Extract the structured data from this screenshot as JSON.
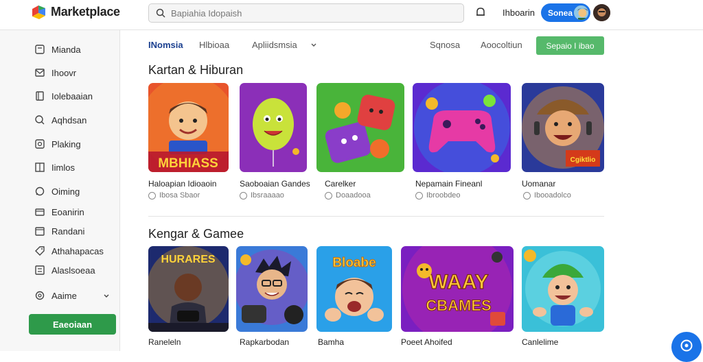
{
  "header": {
    "app_name": "Marketplace",
    "search_placeholder": "Bapiahia Idopaish",
    "signin_link": "Ihboarin",
    "signin_button": "Sonea",
    "bell_icon": "bell-icon",
    "search_icon": "search-icon"
  },
  "sidebar": {
    "items": [
      {
        "label": "Mianda",
        "icon": "card-icon"
      },
      {
        "label": "Ihoovr",
        "icon": "mail-icon"
      },
      {
        "label": "Iolebaaian",
        "icon": "doc-icon"
      },
      {
        "label": "Aqhdsan",
        "icon": "search-icon"
      },
      {
        "label": "Plaking",
        "icon": "image-icon"
      },
      {
        "label": "Iimlos",
        "icon": "grid-icon"
      },
      {
        "label": "Oiming",
        "icon": "chat-icon"
      },
      {
        "label": "Eoanirin",
        "icon": "box-icon"
      },
      {
        "label": "Randani",
        "icon": "calendar-icon"
      },
      {
        "label": "Athahapacas",
        "icon": "tag-icon"
      },
      {
        "label": "Alaslsoeaa",
        "icon": "list-icon"
      },
      {
        "label": "Aaime",
        "icon": "settings-icon"
      }
    ],
    "cta": "Eaeoiaan"
  },
  "subnav": {
    "tabs": [
      "INomsia",
      "Hlbioaa",
      "Apliidsmsia"
    ],
    "right_links": [
      "Sqnosa",
      "Aoocoltiun"
    ],
    "button": "Sepaio I ibao"
  },
  "sections": [
    {
      "title": "Kartan & Hiburan",
      "cards": [
        {
          "title": "Haloapian Idioaoin",
          "meta": "Ibosa Sbaor"
        },
        {
          "title": "Saoboaian Gandes",
          "meta": "Ibsraaaao"
        },
        {
          "title": "Carelker",
          "meta": "Doaadooa"
        },
        {
          "title": "Nepamain Fineanl",
          "meta": "Ibroobdeo"
        },
        {
          "title": "Uomanar",
          "meta": "Ibooadolco"
        }
      ]
    },
    {
      "title": "Kengar & Gamee",
      "cards": [
        {
          "title": "Raneleln"
        },
        {
          "title": "Rapkarbodan"
        },
        {
          "title": "Bamha"
        },
        {
          "title": "Poeet Ahoifed"
        },
        {
          "title": "Canlelime"
        }
      ]
    }
  ],
  "thumb_text": {
    "t1": "MBHIASS",
    "t5": "Cgiktlio",
    "t6": "HURARES",
    "t8": "Bloabe",
    "t9a": "WAAY",
    "t9b": "CBAMES"
  },
  "colors": {
    "primary": "#1a73e8",
    "green_cta": "#2e9a4a",
    "green_button": "#56b96b"
  }
}
